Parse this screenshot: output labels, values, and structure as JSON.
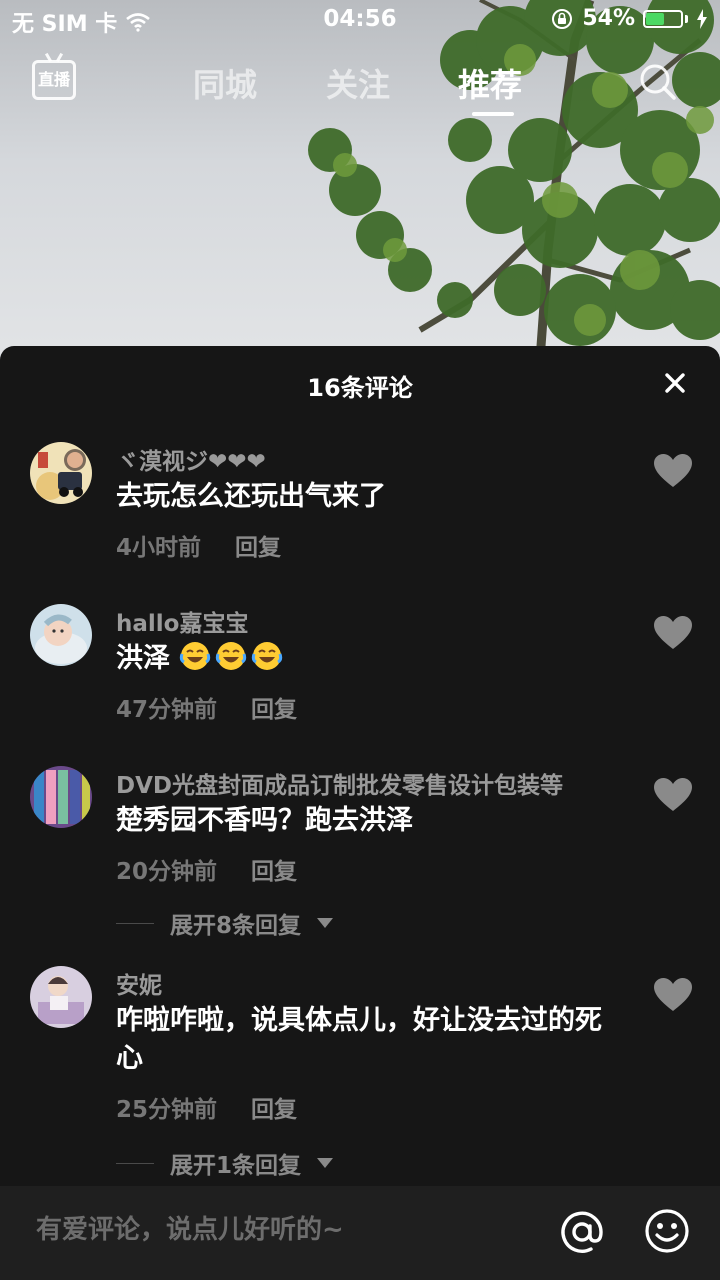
{
  "status_bar": {
    "carrier": "无 SIM 卡",
    "time": "04:56",
    "battery": "54%",
    "battery_level": 0.54
  },
  "nav": {
    "live_label": "直播",
    "tabs": [
      "同城",
      "关注",
      "推荐"
    ],
    "active_tab": "推荐"
  },
  "comments_panel": {
    "title": "16条评论",
    "comments": [
      {
        "user": "ヾ漠视ジ❤❤❤",
        "text": "去玩怎么还玩出气来了",
        "time": "4小时前",
        "reply_label": "回复"
      },
      {
        "user": "hallo嘉宝宝",
        "text": "洪泽",
        "emojis": [
          "crying-laughing-emoji",
          "crying-laughing-emoji",
          "crying-laughing-emoji"
        ],
        "time": "47分钟前",
        "reply_label": "回复"
      },
      {
        "user": "DVD光盘封面成品订制批发零售设计包装等",
        "text": "楚秀园不香吗？跑去洪泽",
        "time": "20分钟前",
        "reply_label": "回复",
        "expand_label": "展开8条回复"
      },
      {
        "user": "安妮",
        "text": "咋啦咋啦，说具体点儿，好让没去过的死心",
        "time": "25分钟前",
        "reply_label": "回复",
        "expand_label": "展开1条回复"
      }
    ]
  },
  "input_bar": {
    "placeholder": "有爱评论，说点儿好听的~"
  },
  "colors": {
    "sheet_bg": "#161616",
    "input_bg": "#1f1f1f",
    "battery_green": "#4cd964"
  }
}
